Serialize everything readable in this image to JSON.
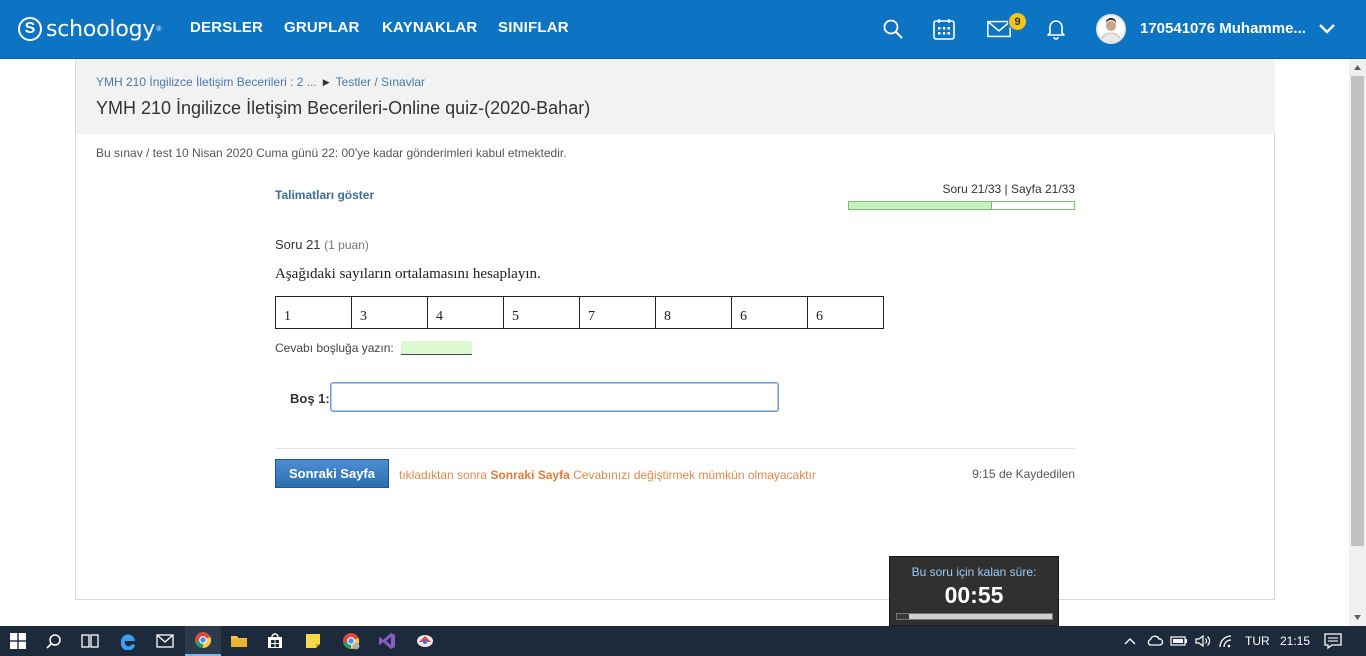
{
  "navbar": {
    "brand": "schoology",
    "brand_mark": "S",
    "brand_tm": "®",
    "items": [
      "DERSLER",
      "GRUPLAR",
      "KAYNAKLAR",
      "SINIFLAR"
    ],
    "messages_badge": "9",
    "username": "170541076 Muhamme..."
  },
  "breadcrumb": {
    "course": "YMH 210 İngilizce İletişim Becerileri : 2 ...",
    "section": "Testler / Sınavlar"
  },
  "page_title": "YMH 210 İngilizce İletişim Becerileri-Online quiz-(2020-Bahar)",
  "notice": "Bu sınav / test 10 Nisan 2020 Cuma günü 22: 00'ye kadar gönderimleri kabul etmektedir.",
  "quiz": {
    "instructions_link": "Talimatları göster",
    "progress_label": "Soru 21/33 | Sayfa 21/33",
    "progress_fraction": 0.636,
    "question_title": "Soru 21",
    "question_points": "(1 puan)",
    "question_text": "Aşağıdaki sayıların ortalamasını hesaplayın.",
    "numbers": [
      "1",
      "3",
      "4",
      "5",
      "7",
      "8",
      "6",
      "6"
    ],
    "fill_prompt": "Cevabı boşluğa yazın:",
    "blank_label": "Boş 1:",
    "blank_value": "",
    "next_button": "Sonraki Sayfa",
    "next_warning_pre": "tıkladıktan sonra",
    "next_warning_bold": "Sonraki Sayfa",
    "next_warning_post": "Cevabınızı değiştirmek mümkün olmayacaktır",
    "saved_status": "9:15 de Kaydedilen"
  },
  "timer": {
    "label": "Bu soru için kalan süre:",
    "value": "00:55",
    "remaining_fraction": 0.92
  },
  "taskbar": {
    "language": "TUR",
    "clock": "21:15"
  },
  "colors": {
    "navbar": "#0d74c4",
    "link": "#4a7aa8",
    "warning": "#e3874a",
    "progress": "#c9f0c0",
    "badge": "#f5c518"
  }
}
